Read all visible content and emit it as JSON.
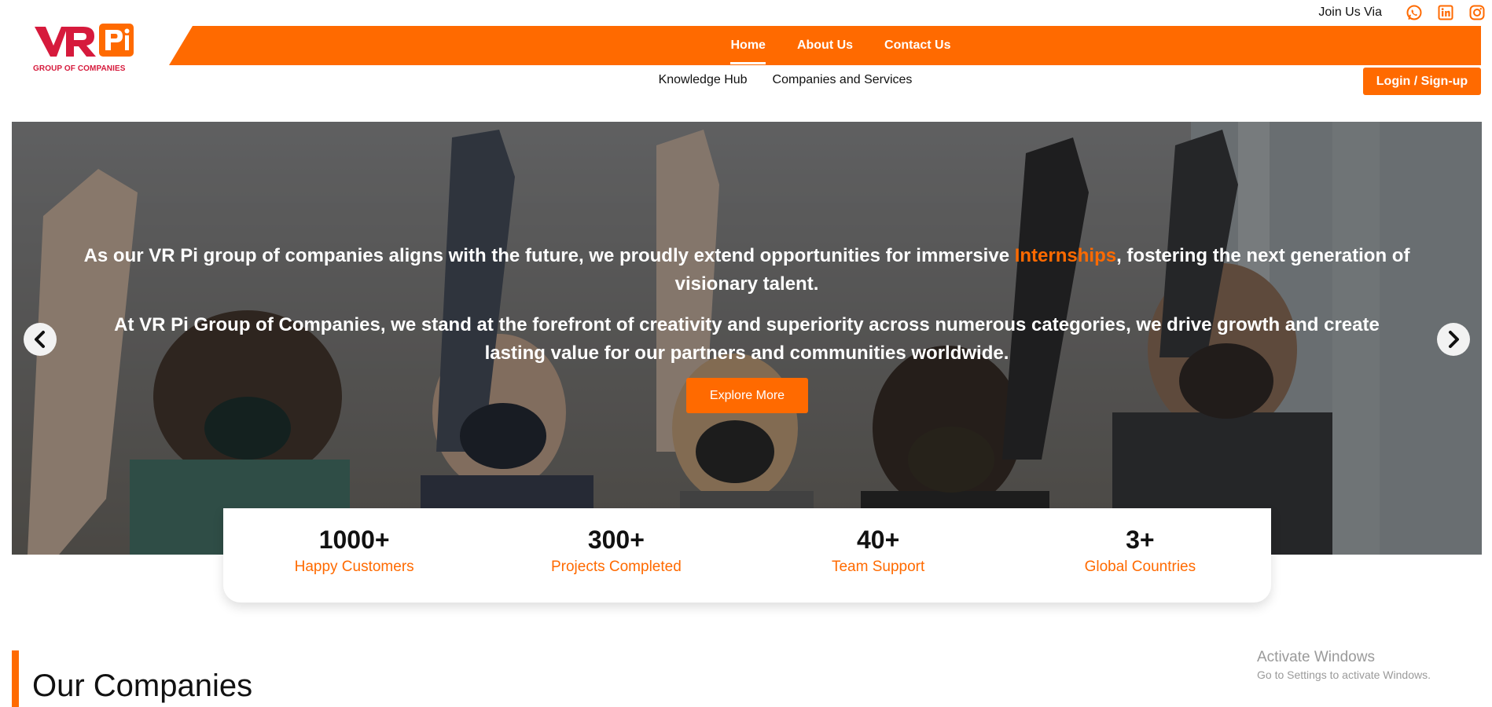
{
  "brand": {
    "logo_text_1": "VR",
    "logo_text_2": "Pi",
    "caption": "GROUP OF COMPANIES",
    "logo_icon": "vrpi-logo",
    "color_red": "#d61a3c",
    "color_orange": "#ff6a00"
  },
  "topbar": {
    "join_text": "Join Us Via",
    "socials": [
      "whatsapp-icon",
      "linkedin-icon",
      "instagram-icon"
    ]
  },
  "nav": {
    "main": [
      {
        "label": "Home",
        "active": true
      },
      {
        "label": "About Us",
        "active": false
      },
      {
        "label": "Contact Us",
        "active": false
      }
    ],
    "sub": [
      "Knowledge Hub",
      "Companies and Services"
    ],
    "login_label": "Login / Sign-up"
  },
  "hero": {
    "para1_before": "As our VR Pi group of companies aligns with the future, we proudly extend opportunities for immersive ",
    "para1_highlight": "Internships",
    "para1_after": ", fostering the next generation of visionary talent.",
    "para2": "At VR Pi Group of Companies, we stand at the forefront of creativity and superiority across numerous categories, we drive growth and create lasting value for our partners and communities worldwide.",
    "cta_label": "Explore More",
    "prev_icon": "chevron-left-icon",
    "next_icon": "chevron-right-icon"
  },
  "stats": [
    {
      "value": "1000+",
      "label": "Happy Customers"
    },
    {
      "value": "300+",
      "label": "Projects Completed"
    },
    {
      "value": "40+",
      "label": "Team Support"
    },
    {
      "value": "3+",
      "label": "Global Countries"
    }
  ],
  "section": {
    "title": "Our Companies"
  },
  "watermark": {
    "line1": "Activate Windows",
    "line2": "Go to Settings to activate Windows."
  }
}
